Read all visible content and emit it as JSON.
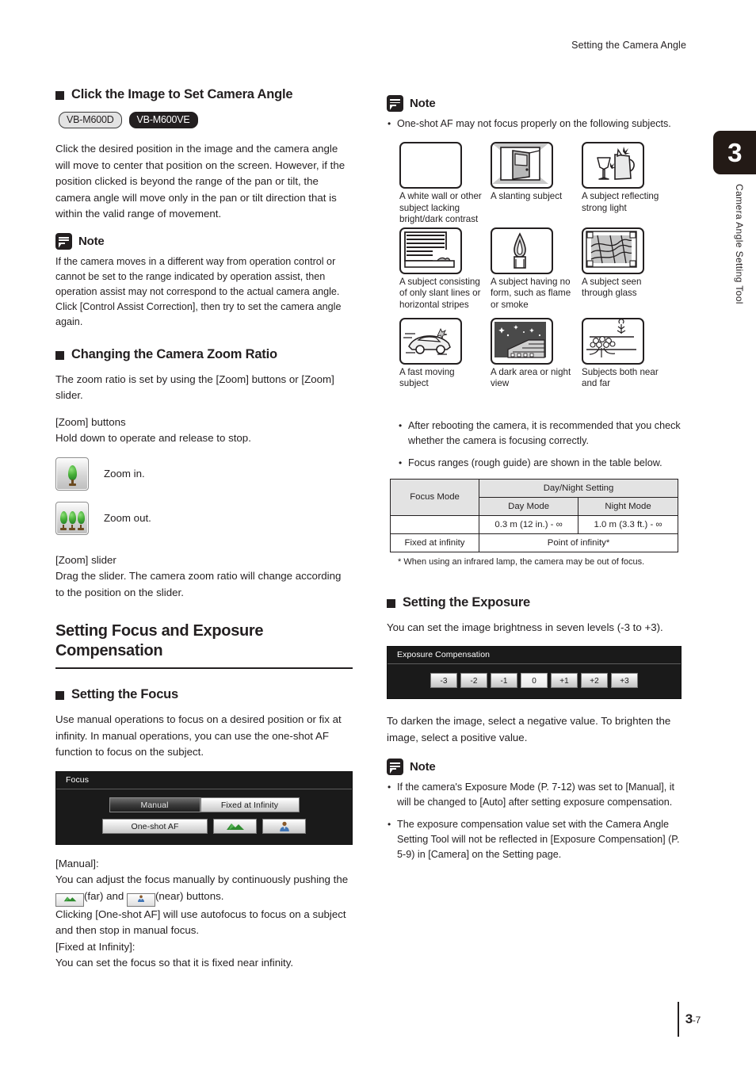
{
  "running_head": "Setting the Camera Angle",
  "side_tab": {
    "number": "3",
    "label": "Camera Angle Setting Tool"
  },
  "footer": {
    "chapter": "3",
    "separator": "-",
    "page": "7"
  },
  "left_column": {
    "section1": {
      "heading": "Click the Image to Set Camera Angle",
      "badges": [
        {
          "text": "VB-M600D",
          "style": "light"
        },
        {
          "text": "VB-M600VE",
          "style": "dark"
        }
      ],
      "body": "Click the desired position in the image and the camera angle will move to center that position on the screen. However, if the position clicked is beyond the range of the pan or tilt, the camera angle will move only in the pan or tilt direction that is within the valid range of movement.",
      "note": {
        "icon": "note-icon",
        "title": "Note",
        "body": "If the camera moves in a different way from operation control or cannot be set to the range indicated by operation assist, then operation assist may not correspond to the actual camera angle. Click [Control Assist Correction], then try to set the camera angle again."
      }
    },
    "section2": {
      "heading": "Changing the Camera Zoom Ratio",
      "body": "The zoom ratio is set by using the [Zoom] buttons or [Zoom] slider.",
      "buttons_label": "[Zoom] buttons",
      "buttons_text": "Hold down to operate and release to stop.",
      "zoom_in_label": "Zoom in.",
      "zoom_out_label": "Zoom out.",
      "slider_label": "[Zoom] slider",
      "slider_text": "Drag the slider. The camera zoom ratio will change according to the position on the slider."
    },
    "section3": {
      "heading": "Setting Focus and Exposure Compensation",
      "sub_heading": "Setting the Focus",
      "body": "Use manual operations to focus on a desired position or fix at infinity. In manual operations, you can use the one-shot AF function to focus on the subject.",
      "focus_panel": {
        "title": "Focus",
        "manual": "Manual",
        "fixed_at_infinity": "Fixed at Infinity",
        "one_shot_af": "One-shot AF",
        "far_icon": "mountain-icon",
        "near_icon": "person-icon",
        "selected": "Manual"
      },
      "explain_manual_label": "[Manual]:",
      "explain_manual_pre": "You can adjust the focus manually by continuously pushing the ",
      "explain_manual_mid": "(far) and ",
      "explain_manual_post": "(near) buttons.",
      "explain_osaf": "Clicking [One-shot AF] will use autofocus to focus on a subject and then stop in manual focus.",
      "explain_fixed_label": "[Fixed at Infinity]:",
      "explain_fixed": "You can set the focus so that it is fixed near infinity."
    }
  },
  "right_column": {
    "note1": {
      "title": "Note",
      "items": [
        "One-shot AF may not focus properly on the following subjects."
      ]
    },
    "samples": [
      {
        "icon": "blank-wall-icon",
        "caption": "A white wall or other subject lacking bright/dark contrast"
      },
      {
        "icon": "slanting-door-icon",
        "caption": "A slanting subject"
      },
      {
        "icon": "glassware-reflection-icon",
        "caption": "A subject reflecting strong light"
      },
      {
        "icon": "horizontal-stripes-icon",
        "caption": "A subject consisting of only slant lines or horizontal stripes"
      },
      {
        "icon": "flame-icon",
        "caption": "A subject having no form, such as flame or smoke"
      },
      {
        "icon": "through-glass-icon",
        "caption": "A subject seen through glass"
      },
      {
        "icon": "fast-car-icon",
        "caption": "A fast moving subject"
      },
      {
        "icon": "night-view-icon",
        "caption": "A dark area or night view"
      },
      {
        "icon": "near-and-far-icon",
        "caption": "Subjects both near and far"
      }
    ],
    "bullets": [
      "After rebooting the camera, it is recommended that you check whether the camera is focusing correctly.",
      "Focus ranges (rough guide) are shown in the table below."
    ],
    "focus_table": {
      "col1_header": "Focus Mode",
      "group_header": "Day/Night Setting",
      "sub_headers": [
        "Day Mode",
        "Night Mode"
      ],
      "rows": [
        {
          "mode": "",
          "day": "0.3 m (12 in.) - ∞",
          "night": "1.0 m (3.3 ft.) - ∞",
          "span": false
        },
        {
          "mode": "Fixed at infinity",
          "merged": "Point of infinity*",
          "span": true
        }
      ],
      "footnote": "* When using an infrared lamp, the camera may be out of focus."
    },
    "exposure": {
      "heading": "Setting the Exposure",
      "body": "You can set the image brightness in seven levels (-3 to +3).",
      "panel": {
        "title": "Exposure Compensation",
        "levels": [
          "-3",
          "-2",
          "-1",
          "0",
          "+1",
          "+2",
          "+3"
        ],
        "selected": "0"
      },
      "body2": "To darken the image, select a negative value. To brighten the image, select a positive value.",
      "note": {
        "title": "Note",
        "items": [
          "If the camera's Exposure Mode (P. 7-12) was set to [Manual], it will be changed to [Auto] after setting exposure compensation.",
          "The exposure compensation value set with the Camera Angle Setting Tool will not be reflected in [Exposure Compensation] (P. 5-9) in [Camera] on the Setting page."
        ]
      }
    }
  }
}
